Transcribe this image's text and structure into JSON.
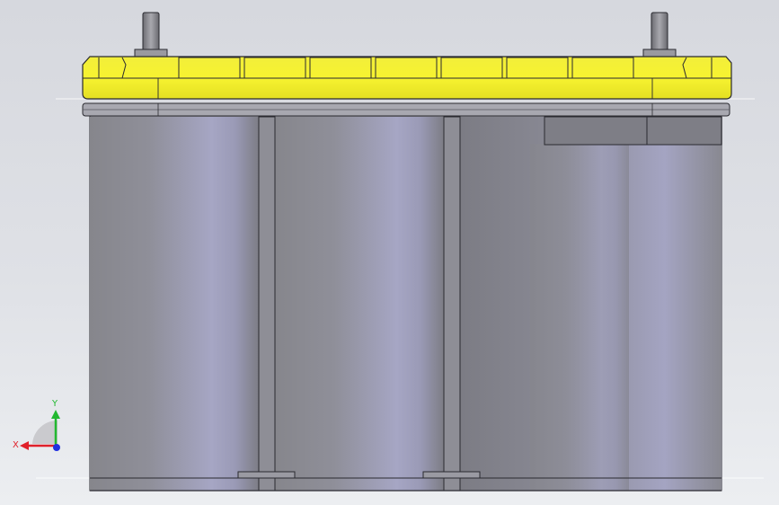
{
  "viewport": {
    "background": "#dcdee3"
  },
  "model": {
    "name": "battery",
    "lid_color": "#f5f02a",
    "case_color": "#8a8a94",
    "terminal_color": "#8c8c92"
  },
  "triad": {
    "x_label": "X",
    "y_label": "Y",
    "x_color": "#e0202a",
    "y_color": "#22b830",
    "z_color": "#2030e0"
  },
  "dimension_text": ""
}
